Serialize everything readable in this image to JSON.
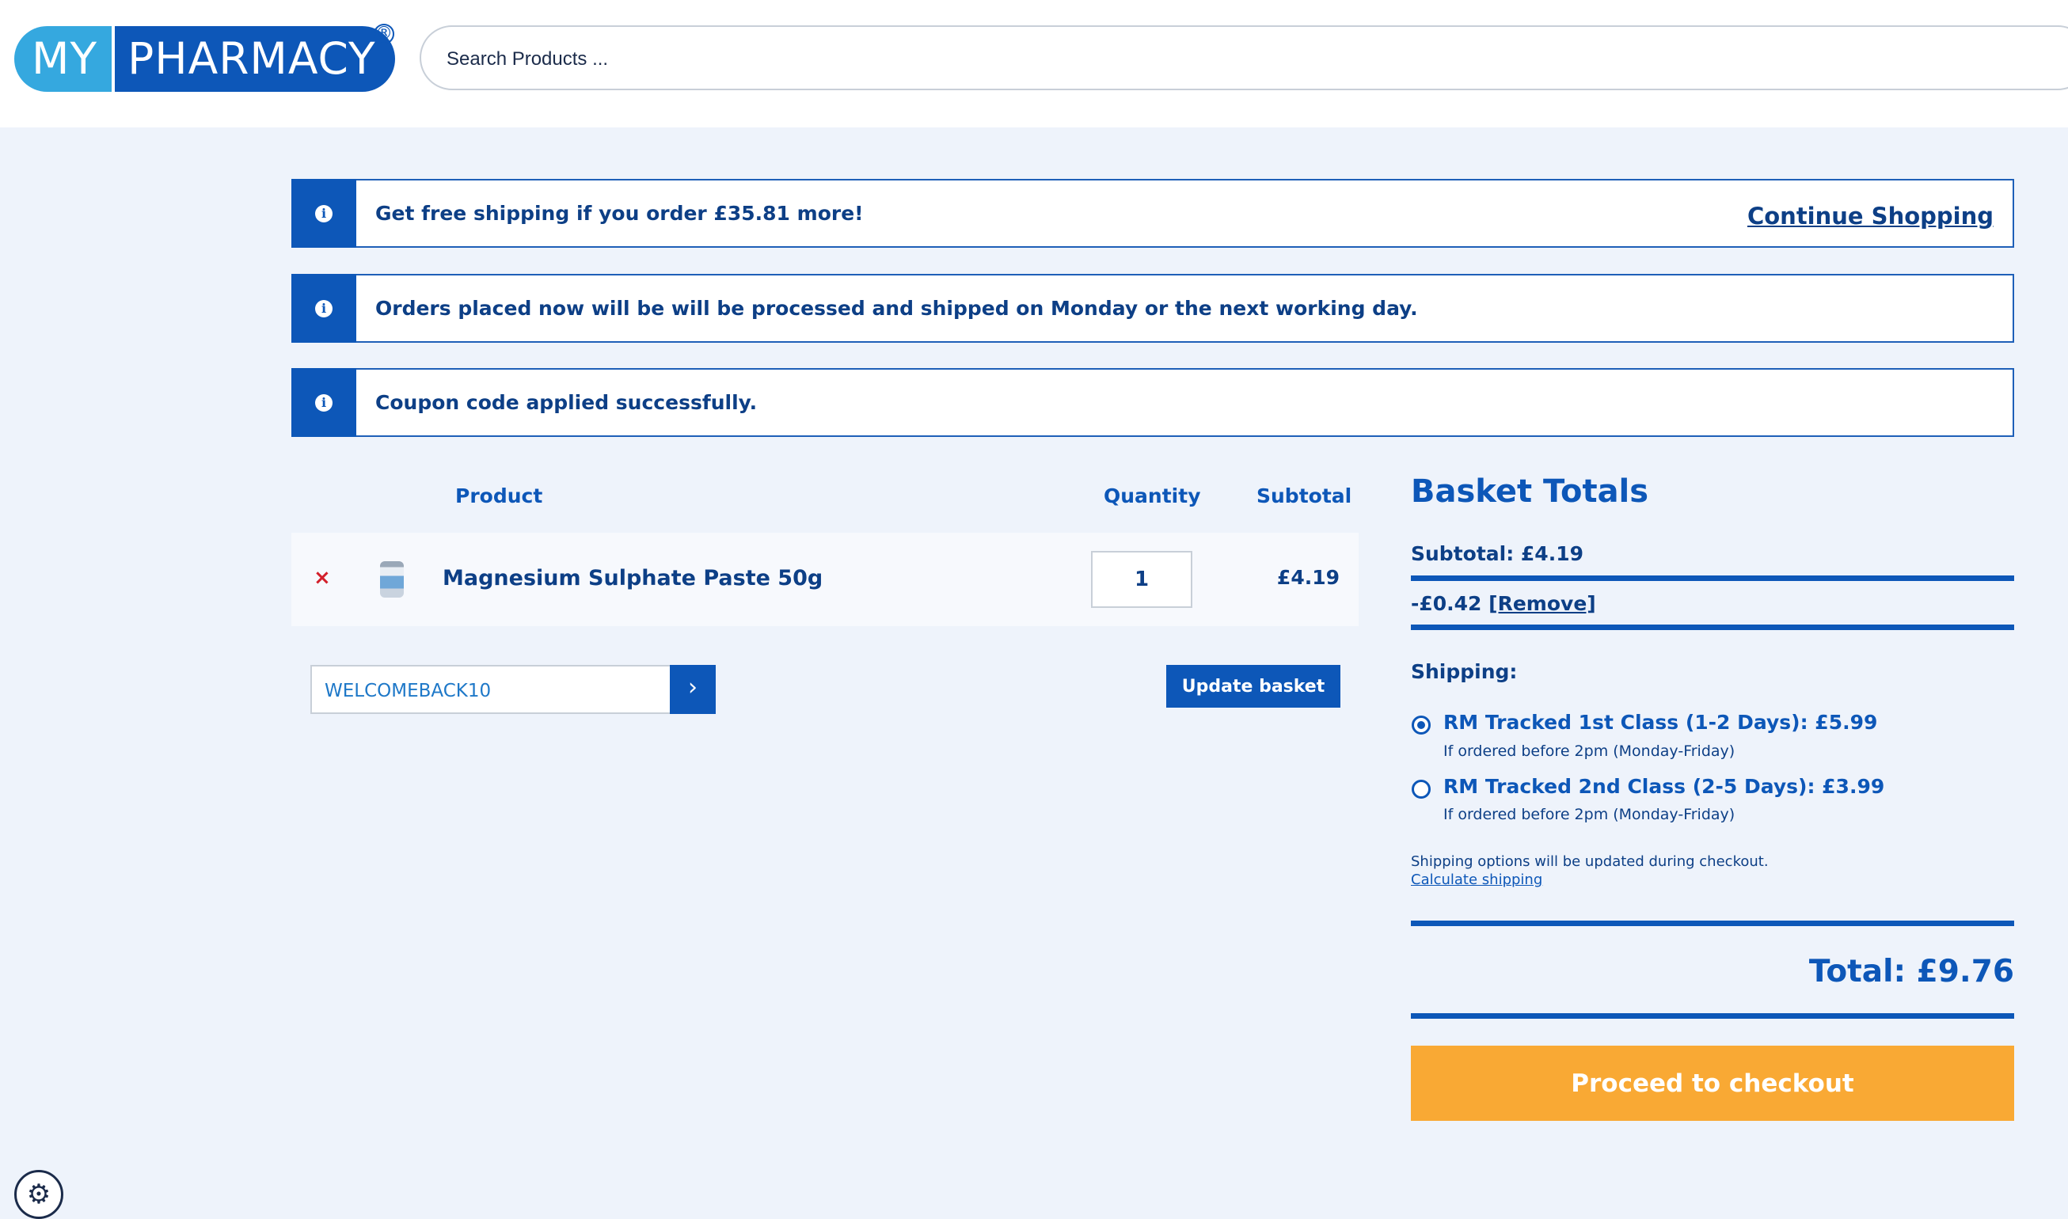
{
  "header": {
    "logo_left": "MY",
    "logo_right": "PHARMACY",
    "logo_reg": "®",
    "search_placeholder": "Search Products ..."
  },
  "notices": [
    {
      "text": "Get free shipping if you order £35.81 more!",
      "link": "Continue Shopping"
    },
    {
      "text": "Orders placed now will be will be processed and shipped on Monday or the next working day."
    },
    {
      "text": "Coupon code applied successfully."
    }
  ],
  "cart": {
    "headers": {
      "product": "Product",
      "quantity": "Quantity",
      "subtotal": "Subtotal"
    },
    "items": [
      {
        "remove": "×",
        "name": "Magnesium Sulphate Paste 50g",
        "quantity": "1",
        "subtotal": "£4.19"
      }
    ],
    "coupon_value": "WELCOMEBACK10",
    "coupon_submit": "›",
    "update_label": "Update basket"
  },
  "totals": {
    "title": "Basket Totals",
    "subtotal": "Subtotal: £4.19",
    "discount": "-£0.42",
    "remove_link": "[Remove]",
    "shipping_heading": "Shipping:",
    "options": [
      {
        "label": "RM Tracked 1st Class (1-2 Days): £5.99",
        "note": "If ordered before 2pm (Monday-Friday)",
        "selected": true
      },
      {
        "label": "RM Tracked 2nd Class (2-5 Days): £3.99",
        "note": "If ordered before 2pm (Monday-Friday)",
        "selected": false
      }
    ],
    "shipping_note": "Shipping options will be updated during checkout.",
    "calculate_link": "Calculate shipping",
    "total": "Total: £9.76",
    "checkout_label": "Proceed to checkout"
  },
  "colors": {
    "brand_dark": "#0d57b8",
    "brand_light": "#35a8df",
    "checkout": "#f9a934",
    "remove": "#d3202b"
  },
  "icons": {
    "notice": "info-icon",
    "settings": "gear-icon"
  }
}
